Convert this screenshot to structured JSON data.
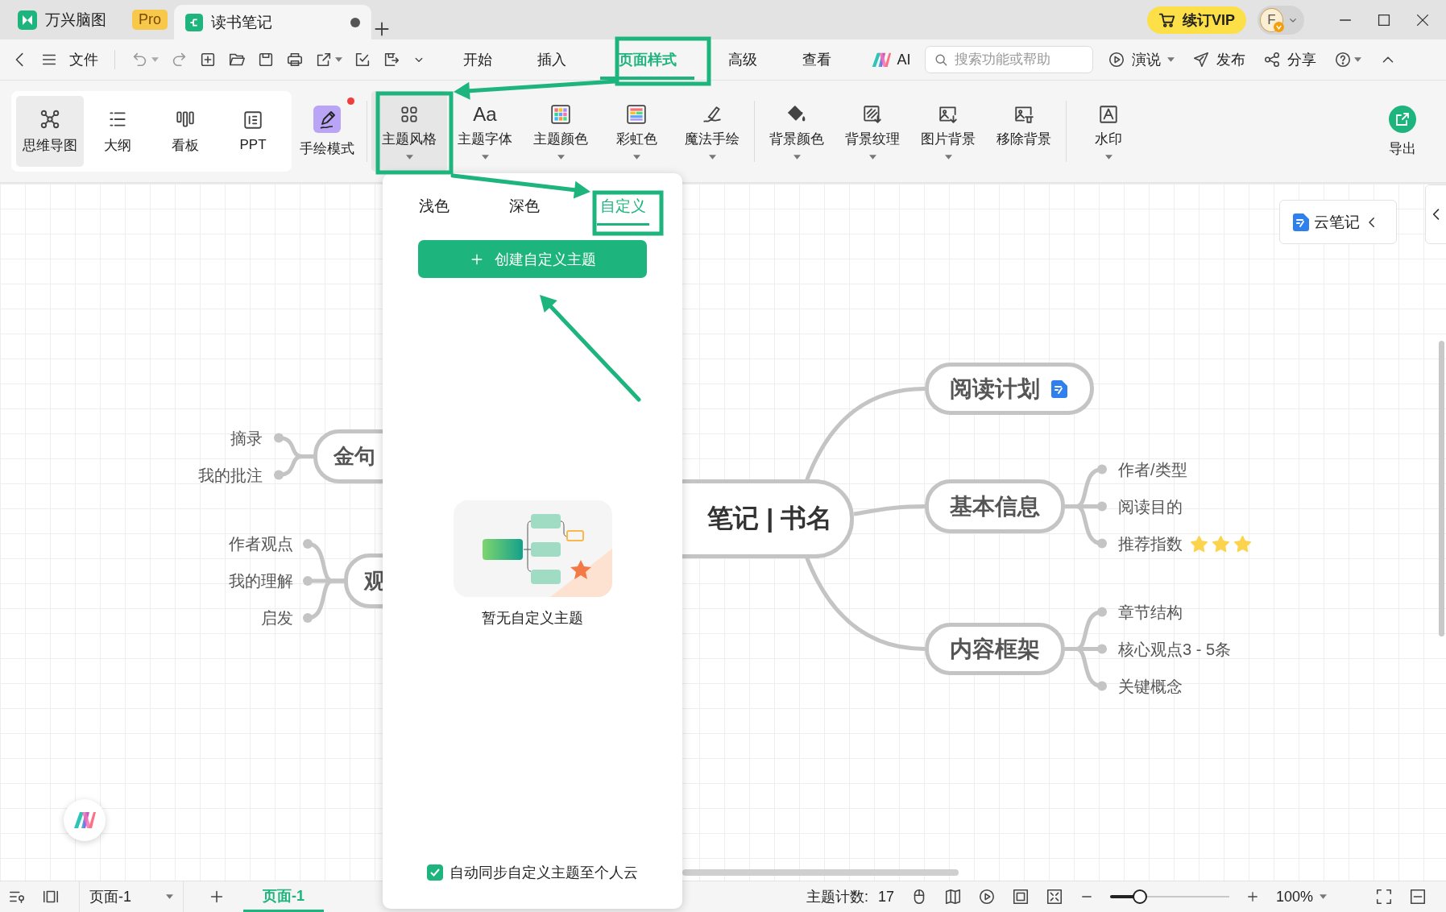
{
  "title_bar": {
    "app_tab": {
      "label": "万兴脑图",
      "badge": "Pro"
    },
    "document_tab": {
      "label": "读书笔记",
      "unsaved": true
    },
    "vip_button": "续订VIP",
    "avatar": "F"
  },
  "menu_bar": {
    "file": "文件",
    "tabs": [
      {
        "label": "开始",
        "kind": "plain",
        "selected": false
      },
      {
        "label": "插入",
        "kind": "plain",
        "selected": false
      },
      {
        "label": "页面样式",
        "kind": "plain",
        "selected": true
      },
      {
        "label": "高级",
        "kind": "plain",
        "selected": false
      },
      {
        "label": "查看",
        "kind": "plain",
        "selected": false
      },
      {
        "label": "AI",
        "kind": "ai",
        "selected": false
      }
    ],
    "search": {
      "placeholder": "搜索功能或帮助"
    },
    "present": "演说",
    "publish": "发布",
    "share": "分享"
  },
  "ribbon": {
    "views": [
      {
        "label": "思维导图",
        "selected": true
      },
      {
        "label": "大纲",
        "selected": false
      },
      {
        "label": "看板",
        "selected": false
      },
      {
        "label": "PPT",
        "selected": false
      }
    ],
    "hand_drawn": {
      "label": "手绘模式",
      "notification": true
    },
    "groups": [
      {
        "items": [
          {
            "label": "主题风格",
            "dropdown": true,
            "selected": true
          },
          {
            "label": "主题字体",
            "icon_text": "Aa",
            "dropdown": true,
            "selected": false
          },
          {
            "label": "主题颜色",
            "dropdown": true,
            "selected": false
          },
          {
            "label": "彩虹色",
            "dropdown": true,
            "selected": false
          },
          {
            "label": "魔法手绘",
            "dropdown": true,
            "selected": false
          }
        ]
      },
      {
        "items": [
          {
            "label": "背景颜色",
            "dropdown": true,
            "selected": false
          },
          {
            "label": "背景纹理",
            "dropdown": true,
            "selected": false
          },
          {
            "label": "图片背景",
            "dropdown": true,
            "selected": false
          },
          {
            "label": "移除背景",
            "dropdown": false,
            "selected": false
          }
        ]
      },
      {
        "items": [
          {
            "label": "水印",
            "dropdown": true,
            "selected": false
          }
        ]
      }
    ],
    "export": "导出"
  },
  "theme_panel": {
    "tabs": [
      {
        "label": "浅色",
        "selected": false
      },
      {
        "label": "深色",
        "selected": false
      },
      {
        "label": "自定义",
        "selected": true
      }
    ],
    "create_button": "创建自定义主题",
    "empty_text": "暂无自定义主题",
    "sync": {
      "label": "自动同步自定义主题至个人云",
      "checked": true
    }
  },
  "mind_map": {
    "central": "笔记 | 书名",
    "right_topics": [
      {
        "label": "阅读计划",
        "note": true
      },
      {
        "label": "基本信息",
        "note": false,
        "children": [
          {
            "label": "作者/类型"
          },
          {
            "label": "阅读目的"
          },
          {
            "label": "推荐指数",
            "stars": 3
          }
        ]
      },
      {
        "label": "内容框架",
        "note": false,
        "children": [
          {
            "label": "章节结构"
          },
          {
            "label": "核心观点3 - 5条"
          },
          {
            "label": "关键概念"
          }
        ]
      }
    ],
    "left_topics": [
      {
        "label": "金句",
        "children": [
          {
            "label": "摘录"
          },
          {
            "label": "我的批注"
          }
        ]
      },
      {
        "label": "观",
        "children": [
          {
            "label": "作者观点"
          },
          {
            "label": "我的理解"
          },
          {
            "label": "启发"
          }
        ]
      }
    ]
  },
  "cloud_note": "云笔记",
  "status_bar": {
    "page_select": "页面-1",
    "pages": [
      {
        "label": "页面-1",
        "selected": true
      }
    ],
    "topic_count_label": "主题计数:",
    "topic_count": "17",
    "zoom": {
      "level": 0.25,
      "value": "100%"
    }
  }
}
